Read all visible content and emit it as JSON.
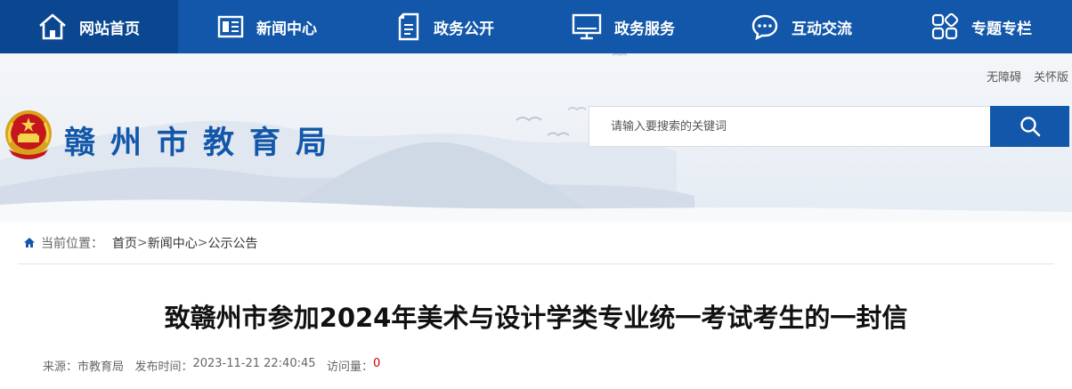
{
  "nav": {
    "items": [
      {
        "label": "网站首页",
        "icon": "home-icon"
      },
      {
        "label": "新闻中心",
        "icon": "newspaper-icon"
      },
      {
        "label": "政务公开",
        "icon": "document-icon"
      },
      {
        "label": "政务服务",
        "icon": "monitor-icon"
      },
      {
        "label": "互动交流",
        "icon": "chat-icon"
      },
      {
        "label": "专题专栏",
        "icon": "grid-icon"
      }
    ]
  },
  "header": {
    "site_title": "赣州市教育局",
    "accessibility_link": "无障碍",
    "elderly_link": "关怀版",
    "search_placeholder": "请输入要搜索的关键词"
  },
  "breadcrumb": {
    "label": "当前位置：",
    "items": [
      "首页",
      "新闻中心",
      "公示公告"
    ],
    "separator": ">"
  },
  "article": {
    "title": "致赣州市参加2024年美术与设计学类专业统一考试考生的一封信",
    "source_label": "来源：",
    "source": "市教育局",
    "publish_label": "发布时间：",
    "publish_time": "2023-11-21 22:40:45",
    "views_label": "访问量：",
    "views": "0"
  },
  "colors": {
    "brand_blue": "#1257a9",
    "nav_active": "#0b4690",
    "views_red": "#cc0000"
  }
}
